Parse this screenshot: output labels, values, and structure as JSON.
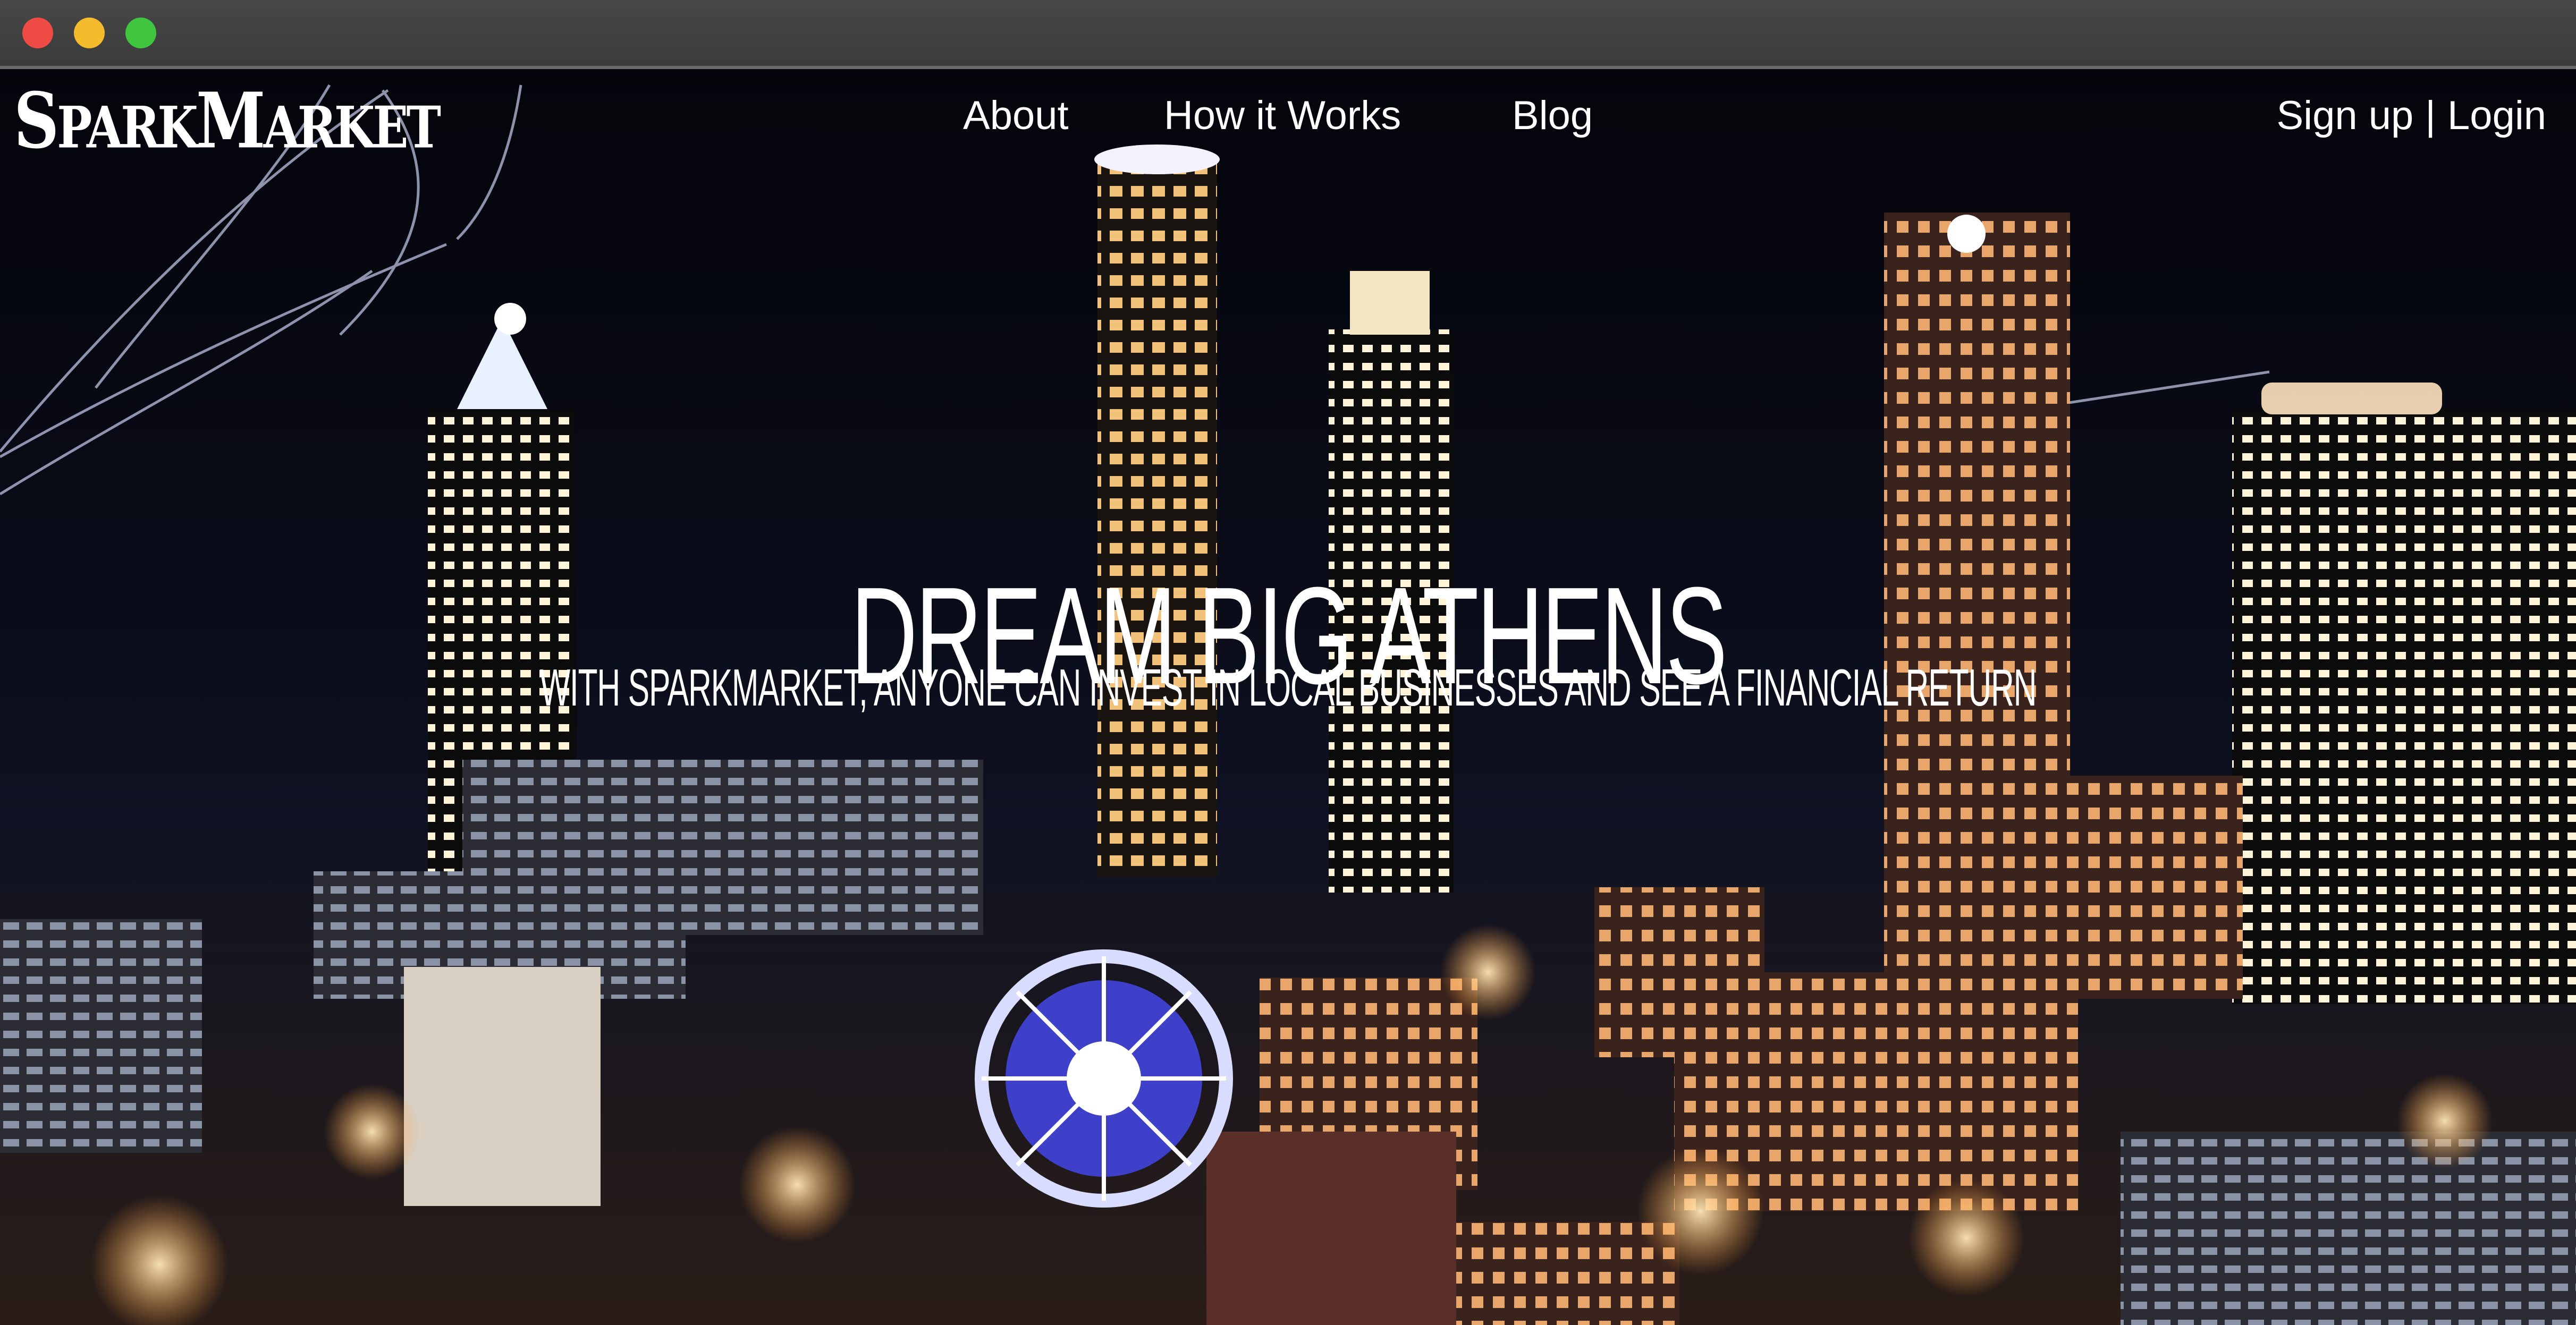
{
  "brand": {
    "text_big_1": "S",
    "text_small_1": "PARK",
    "text_big_2": "M",
    "text_small_2": "ARKET"
  },
  "nav": {
    "about": "About",
    "how_it_works": "How it Works",
    "blog": "Blog"
  },
  "auth": {
    "sign_up": "Sign up",
    "separator": "|",
    "login": "Login"
  },
  "hero": {
    "title": "DREAM BIG ATHENS",
    "subtitle": "WITH SPARKMARKET, ANYONE CAN INVEST IN LOCAL BUSINESSES AND SEE A FINANCIAL RETURN"
  },
  "colors": {
    "titlebar": "#3d3d3d",
    "traffic_red": "#ee4b45",
    "traffic_yellow": "#f4bb2c",
    "traffic_green": "#3fc53f",
    "text": "#ffffff",
    "sky": "#06070d"
  }
}
